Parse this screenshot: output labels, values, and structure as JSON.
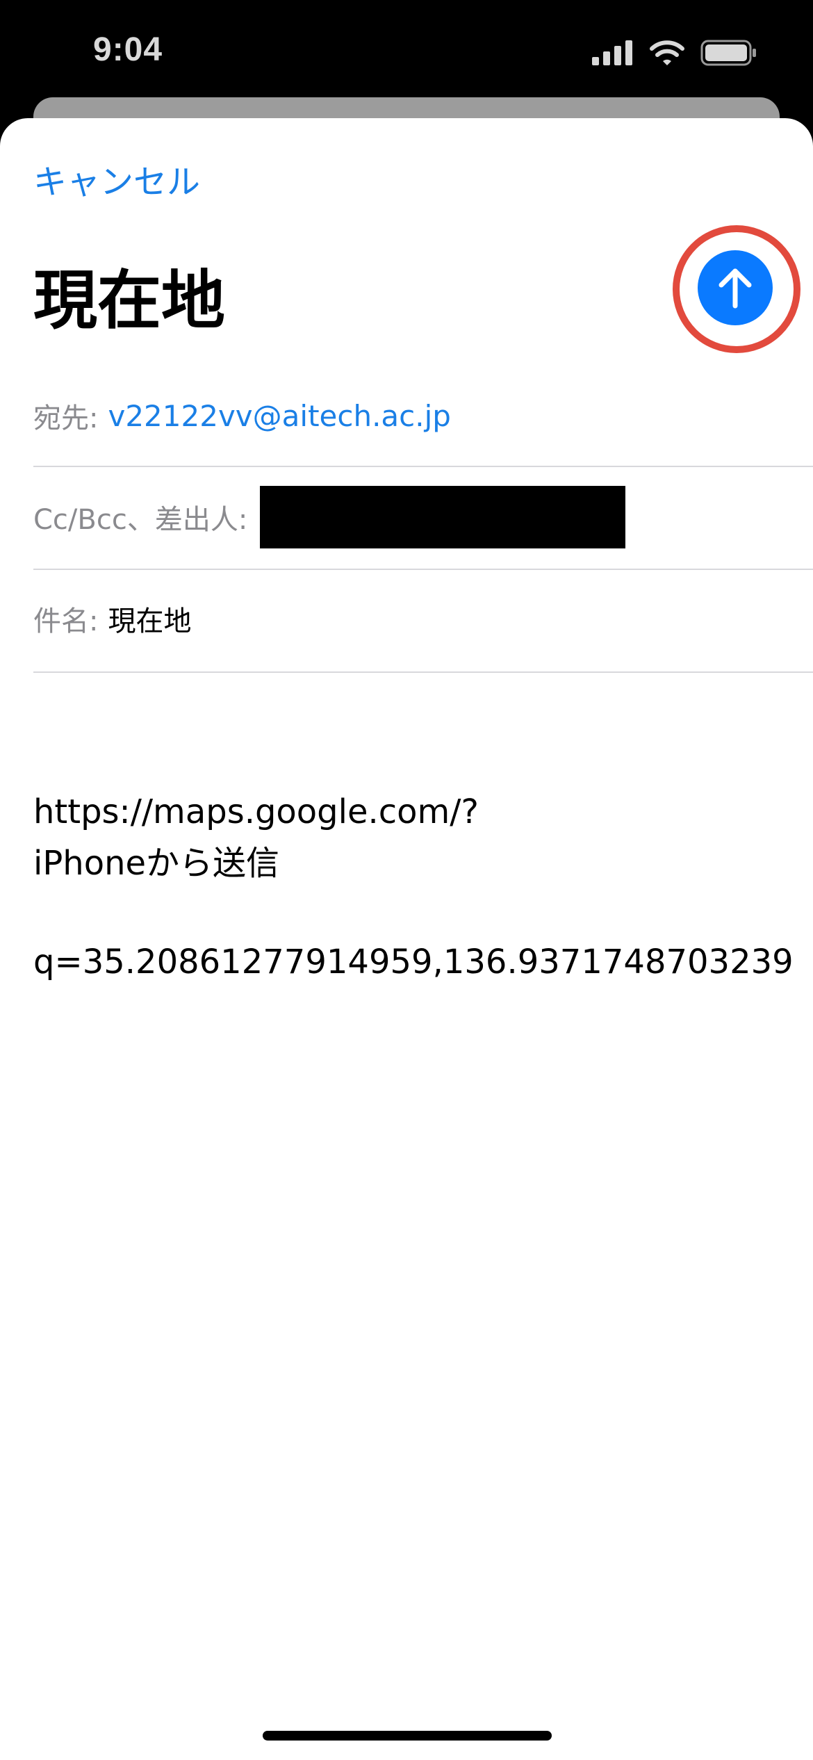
{
  "status_bar": {
    "time": "9:04",
    "icons": [
      "cellular-signal-icon",
      "wifi-icon",
      "battery-icon"
    ]
  },
  "compose": {
    "cancel_label": "キャンセル",
    "title": "現在地",
    "send_icon": "arrow-up-icon",
    "fields": {
      "to_label": "宛先:",
      "to_value": "v22122vv@aitech.ac.jp",
      "ccbcc_label": "Cc/Bcc、差出人:",
      "subject_label": "件名:",
      "subject_value": "現在地"
    },
    "body_line1": "https://maps.google.com/?",
    "body_line2": "q=35.20861277914959,136.9371748703239",
    "signature": "iPhoneから送信"
  },
  "colors": {
    "accent": "#1a7fe6",
    "send_button": "#0a7aff",
    "highlight_ring": "#e24a3d",
    "label_gray": "#8a8a8e"
  }
}
